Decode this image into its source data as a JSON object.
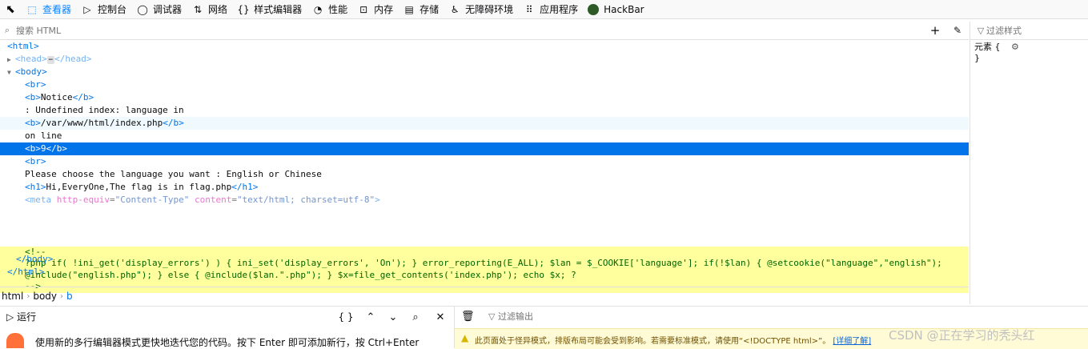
{
  "toolbar": {
    "tabs": [
      {
        "label": "查看器",
        "icon": "inspector-icon",
        "glyph": "⬚"
      },
      {
        "label": "控制台",
        "icon": "console-icon",
        "glyph": "▷"
      },
      {
        "label": "调试器",
        "icon": "debugger-icon",
        "glyph": "◯"
      },
      {
        "label": "网络",
        "icon": "network-icon",
        "glyph": "⇅"
      },
      {
        "label": "样式编辑器",
        "icon": "style-editor-icon",
        "glyph": "{ }"
      },
      {
        "label": "性能",
        "icon": "performance-icon",
        "glyph": "◔"
      },
      {
        "label": "内存",
        "icon": "memory-icon",
        "glyph": "⊡"
      },
      {
        "label": "存储",
        "icon": "storage-icon",
        "glyph": "▤"
      },
      {
        "label": "无障碍环境",
        "icon": "accessibility-icon",
        "glyph": "♿"
      },
      {
        "label": "应用程序",
        "icon": "application-icon",
        "glyph": "⠿"
      },
      {
        "label": "HackBar",
        "icon": "hackbar-icon",
        "glyph": ""
      }
    ],
    "selected": "查看器"
  },
  "search": {
    "placeholder": "搜索 HTML"
  },
  "tree": {
    "html_open": "<html>",
    "head": {
      "open": "<head>",
      "close": "</head>",
      "ellipsis": "⋯"
    },
    "body_open": "<body>",
    "br1": "<br>",
    "notice": {
      "open": "<b>",
      "text": "Notice",
      "close": "</b>"
    },
    "undefined_text": ": Undefined index: language in",
    "path_b": {
      "open": "<b>",
      "text": "/var/www/html/index.php",
      "close": "</b>"
    },
    "on_line": "on line",
    "line_b": {
      "open": "<b>",
      "text": "9",
      "close": "</b>"
    },
    "br2": "<br>",
    "choose_text": "Please choose the language you want : English or Chinese",
    "h1": {
      "open": "<h1>",
      "text": "Hi,EveryOne,The flag is in flag.php",
      "close": "</h1>"
    },
    "meta": {
      "open": "<meta",
      "attr1": "http-equiv",
      "val1": "\"Content-Type\"",
      "attr2": "content",
      "val2": "\"text/html; charset=utf-8\"",
      "close": ">"
    },
    "comment": [
      "<!--",
      "?php if( !ini_get('display_errors') ) { ini_set('display_errors', 'On'); } error_reporting(E_ALL); $lan = $_COOKIE['language']; if(!$lan) { @setcookie(\"language\",\"english\");",
      "@include(\"english.php\"); } else { @include($lan.\".php\"); } $x=file_get_contents('index.php'); echo $x; ?",
      "-->"
    ],
    "body_close": "</body>",
    "html_close": "</html>"
  },
  "breadcrumbs": [
    "html",
    "body",
    "b"
  ],
  "rules": {
    "filter_placeholder": "过滤样式",
    "element_rule_open": "元素 {",
    "element_rule_close": "}"
  },
  "console": {
    "run_label": "运行",
    "braces_label": "{ }",
    "filter_placeholder": "过滤输出",
    "hint": "使用新的多行编辑器模式更快地迭代您的代码。按下 Enter 即可添加新行，按 Ctrl+Enter",
    "warning": "此页面处于怪异模式，排版布局可能会受到影响。若需要标准模式，请使用“<!DOCTYPE html>”。",
    "warning_link": "[详细了解]"
  },
  "watermark": "CSDN @正在学习的秃头红",
  "colors": {
    "accent": "#0a84ff",
    "selection": "#0074e8",
    "comment_bg": "#ffff9e",
    "warning_bg": "#fffbd6"
  }
}
